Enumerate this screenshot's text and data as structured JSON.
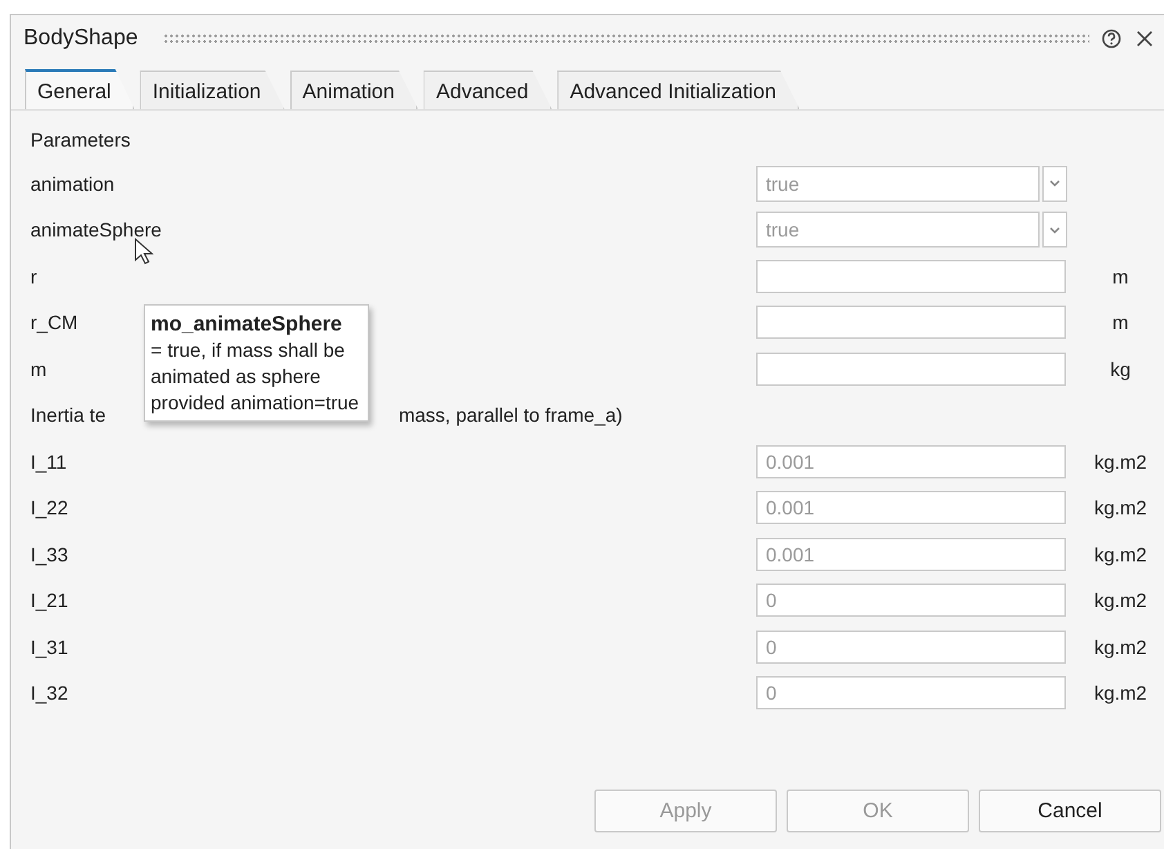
{
  "window": {
    "title": "BodyShape"
  },
  "tabs": [
    {
      "label": "General",
      "selected": true
    },
    {
      "label": "Initialization",
      "selected": false
    },
    {
      "label": "Animation",
      "selected": false
    },
    {
      "label": "Advanced",
      "selected": false
    },
    {
      "label": "Advanced Initialization",
      "selected": false
    }
  ],
  "section": "Parameters",
  "parameters": [
    {
      "kind": "combo",
      "name": "animation",
      "placeholder": "true"
    },
    {
      "kind": "combo",
      "name": "animateSphere",
      "placeholder": "true"
    },
    {
      "kind": "text",
      "name": "r",
      "unit": "m"
    },
    {
      "kind": "text",
      "name": "r_CM",
      "unit": "m"
    },
    {
      "kind": "text",
      "name": "m",
      "unit": "kg"
    },
    {
      "kind": "heading",
      "parts": [
        "Inertia te",
        "mass, parallel to frame_a)"
      ]
    },
    {
      "kind": "text",
      "name": "I_11",
      "placeholder": "0.001",
      "unit": "kg.m2"
    },
    {
      "kind": "text",
      "name": "I_22",
      "placeholder": "0.001",
      "unit": "kg.m2"
    },
    {
      "kind": "text",
      "name": "I_33",
      "placeholder": "0.001",
      "unit": "kg.m2"
    },
    {
      "kind": "text",
      "name": "I_21",
      "placeholder": "0",
      "unit": "kg.m2"
    },
    {
      "kind": "text",
      "name": "I_31",
      "placeholder": "0",
      "unit": "kg.m2"
    },
    {
      "kind": "text",
      "name": "I_32",
      "placeholder": "0",
      "unit": "kg.m2"
    }
  ],
  "tooltip": {
    "title": "mo_animateSphere",
    "lines": [
      "= true, if mass shall be",
      "animated as sphere",
      "provided animation=true"
    ]
  },
  "buttons": [
    {
      "label": "Apply",
      "disabled": true
    },
    {
      "label": "OK",
      "disabled": true
    },
    {
      "label": "Cancel",
      "disabled": false
    }
  ]
}
